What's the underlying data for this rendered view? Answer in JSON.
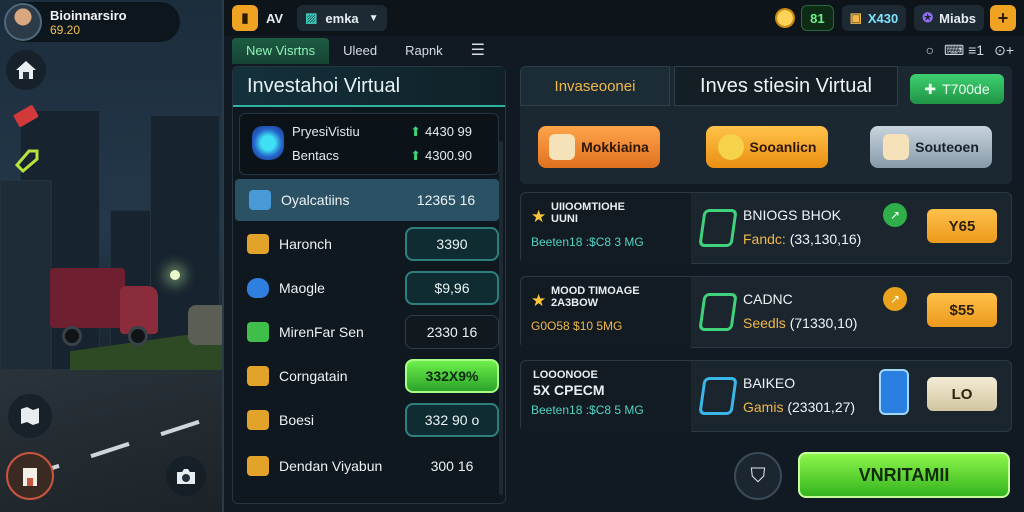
{
  "player": {
    "name": "Bioinnarsiro",
    "cash": "69.20"
  },
  "left_buttons": {
    "home": "home-icon",
    "ticket": "ticket-icon",
    "tag": "tag-icon",
    "map": "map-icon",
    "camera": "camera-icon",
    "build": "building-icon"
  },
  "topbar": {
    "app_tag": "AV",
    "dropdown_label": "emka",
    "coins": "81",
    "gems": "X430",
    "rank_label": "Miabs",
    "add_label": "+"
  },
  "tabs": [
    {
      "label": "New Visrtns"
    },
    {
      "label": "Uleed"
    },
    {
      "label": "Rapnk"
    }
  ],
  "right_tools": [
    "○",
    "⌨ ≡1",
    "⊙+"
  ],
  "list": {
    "title": "Investahoi Virtual",
    "featured": {
      "row1_label": "PryesiVistiu",
      "row1_value": "4430 99",
      "row2_label": "Bentacs",
      "row2_value": "4300.90"
    },
    "items": [
      {
        "label": "Oyalcatiins",
        "value": "12365 16"
      },
      {
        "label": "Haronch",
        "value": "3390"
      },
      {
        "label": "Maogle",
        "value": "$9,96"
      },
      {
        "label": "MirenFar Sen",
        "value": "2330 16"
      },
      {
        "label": "Corngatain",
        "value": "332X9%"
      },
      {
        "label": "Boesi",
        "value": "332 90 o"
      },
      {
        "label": "Dendan Viyabun",
        "value": "300 16"
      }
    ]
  },
  "panel": {
    "tab_label": "Invaseoonei",
    "title": "Inves stiesin Virtual",
    "price": "T700de",
    "actions": [
      {
        "label": "Mokkiaina",
        "color": "#f08a2a"
      },
      {
        "label": "Sooanlicn",
        "color": "#f6a21f"
      },
      {
        "label": "Souteoen",
        "color": "#9fb2c2"
      }
    ]
  },
  "cards": [
    {
      "title_line1": "UIIOOMTIOHE",
      "title_line2": "UUNI",
      "sub": "Beeten18 :$C8 3 MG",
      "name": "BNIOGS BHOK",
      "detail_label": "Fandc:",
      "detail_value": "(33,130,16)",
      "circle": "↗",
      "price": "Y65"
    },
    {
      "title_line1": "MOOD TIMOAGE",
      "title_line2": "2A3BOW",
      "sub": "G0O58 $10 5MG",
      "name": "CADNC",
      "detail_label": "Seedls",
      "detail_value": "(71330,10)",
      "circle": "↗",
      "price": "$55"
    },
    {
      "title_line1": "LOOONOOE",
      "title_line2": "5X  CPECM",
      "sub": "Beeten18 :$C8 5 MG",
      "name": "BAIKEO",
      "detail_label": "Gamis",
      "detail_value": "(23301,27)",
      "circle": "",
      "price": "LO"
    }
  ],
  "primary_button": "VNRITAMII",
  "colors": {
    "accent_green": "#3fd27a",
    "teal": "#2fb3a0",
    "gold": "#f2b84a"
  }
}
